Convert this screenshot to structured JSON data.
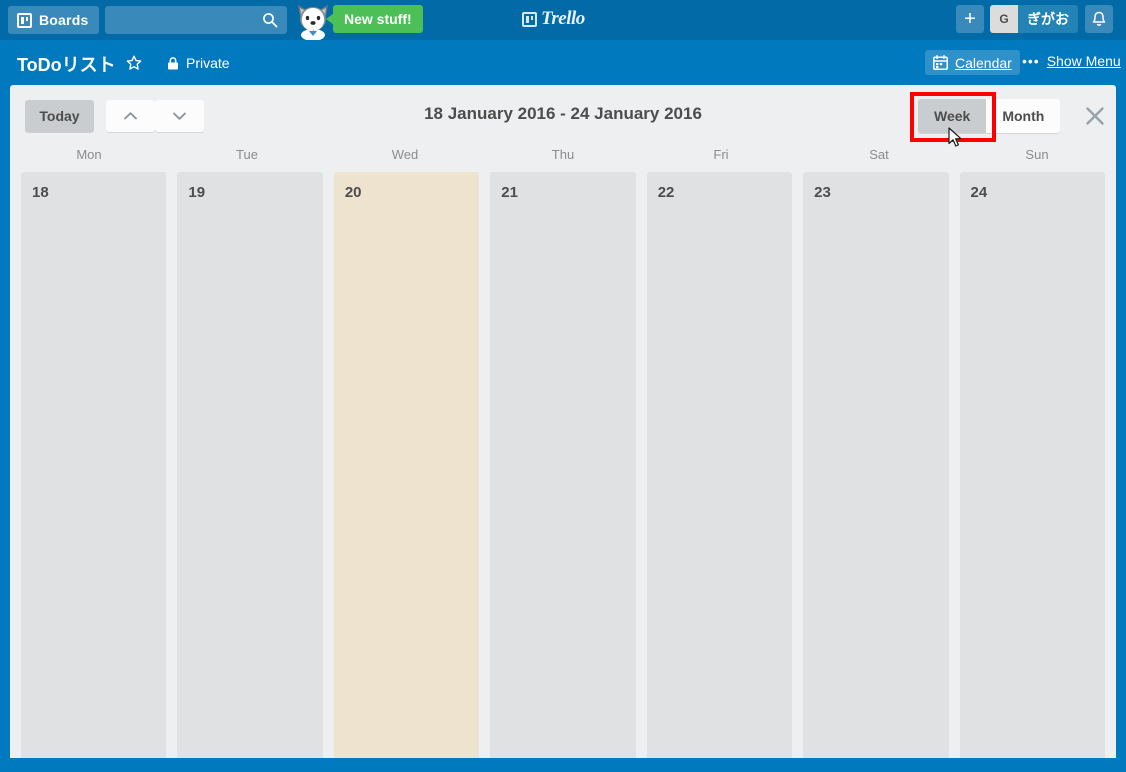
{
  "top_bar": {
    "boards_button": "Boards",
    "boards_icon": "board-icon",
    "search_placeholder": "",
    "search_value": "",
    "search_icon": "search-icon",
    "mascot": "husky-mascot",
    "new_stuff_label": "New stuff!",
    "brand": "Trello",
    "add_label": "+",
    "member_initial": "G",
    "member_name": "ぎがお",
    "notifications_icon": "bell-icon",
    "colors": {
      "nav_bg": "#026AA7",
      "board_bg": "#0079BF",
      "new_stuff_green": "#4CBF56"
    }
  },
  "board_header": {
    "title": "ToDoリスト",
    "star_icon": "star-icon",
    "lock_icon": "lock-icon",
    "visibility": "Private",
    "calendar_icon": "calendar-icon",
    "calendar_label": "Calendar",
    "menu_dots": "•••",
    "show_menu_label": "Show Menu"
  },
  "calendar": {
    "today_label": "Today",
    "prev_icon": "chevron-up-icon",
    "next_icon": "chevron-down-icon",
    "range_title": "18 January 2016 - 24 January 2016",
    "views": [
      {
        "label": "Week",
        "active": true
      },
      {
        "label": "Month",
        "active": false
      }
    ],
    "close_icon": "close-icon",
    "weekdays": [
      "Mon",
      "Tue",
      "Wed",
      "Thu",
      "Fri",
      "Sat",
      "Sun"
    ],
    "days": [
      {
        "number": "18",
        "today": false
      },
      {
        "number": "19",
        "today": false
      },
      {
        "number": "20",
        "today": true
      },
      {
        "number": "21",
        "today": false
      },
      {
        "number": "22",
        "today": false
      },
      {
        "number": "23",
        "today": false
      },
      {
        "number": "24",
        "today": false
      }
    ],
    "highlight_color": "#FF0000",
    "today_column_color": "#EDE3CE",
    "column_color": "#DFE1E2"
  }
}
